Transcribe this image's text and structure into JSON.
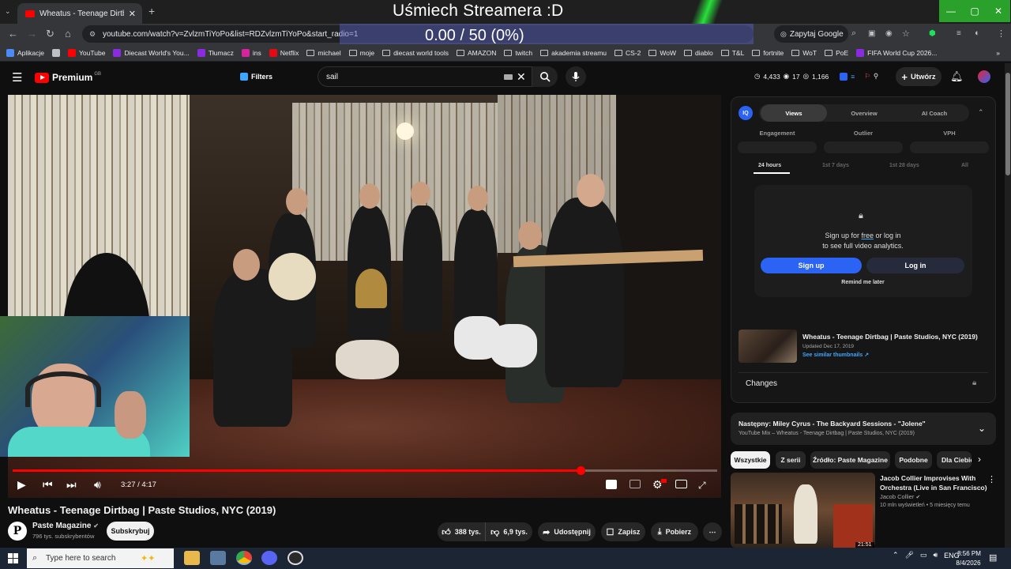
{
  "browser": {
    "tab_title": "Wheatus - Teenage Dirtbag | Pa",
    "url": "youtube.com/watch?v=ZvlzmTiYoPo&list=RDZvlzmTiYoPo&start_radio=1",
    "ask_google_label": "Zapytaj Google"
  },
  "overlay": {
    "stream_title": "Uśmiech Streamera :D",
    "counter": "0.00 / 50 (0%)"
  },
  "bookmarks": [
    {
      "label": "Aplikacje",
      "kind": "apps"
    },
    {
      "label": "",
      "kind": "grid"
    },
    {
      "label": "YouTube",
      "kind": "yt"
    },
    {
      "label": "Diecast World's You...",
      "kind": "site"
    },
    {
      "label": "Tłumacz",
      "kind": "site"
    },
    {
      "label": "ins",
      "kind": "insta"
    },
    {
      "label": "Netflix",
      "kind": "netflix"
    },
    {
      "label": "michael",
      "kind": "folder"
    },
    {
      "label": "moje",
      "kind": "folder"
    },
    {
      "label": "diecast world tools",
      "kind": "folder"
    },
    {
      "label": "AMAZON",
      "kind": "folder"
    },
    {
      "label": "twitch",
      "kind": "folder"
    },
    {
      "label": "akademia streamu",
      "kind": "folder"
    },
    {
      "label": "CS-2",
      "kind": "folder"
    },
    {
      "label": "WoW",
      "kind": "folder"
    },
    {
      "label": "diablo",
      "kind": "folder"
    },
    {
      "label": "T&L",
      "kind": "folder"
    },
    {
      "label": "fortnite",
      "kind": "folder"
    },
    {
      "label": "WoT",
      "kind": "folder"
    },
    {
      "label": "PoE",
      "kind": "folder"
    },
    {
      "label": "FIFA World Cup 2026...",
      "kind": "site"
    }
  ],
  "header": {
    "brand": "Premium",
    "brand_region": "GB",
    "filters_label": "Filters",
    "search_value": "sail",
    "stats": {
      "views": "4,433",
      "watch": "17",
      "eye": "1,166"
    },
    "create_label": "Utwórz"
  },
  "player": {
    "current_time": "3:27 / 4:17",
    "progress": 0.806
  },
  "video": {
    "title": "Wheatus - Teenage Dirtbag | Paste Studios, NYC (2019)",
    "channel": "Paste Magazine",
    "channel_initial": "P",
    "subscribers": "796 tys. subskrybentów",
    "subscribe_label": "Subskrybuj",
    "likes": "388 tys.",
    "dislikes": "6,9 tys.",
    "share_label": "Udostępnij",
    "save_label": "Zapisz",
    "download_label": "Pobierz"
  },
  "iq_panel": {
    "badge": "IQ",
    "tabs": [
      "Views",
      "Overview",
      "AI Coach"
    ],
    "metrics": [
      "Engagement",
      "Outlier",
      "VPH"
    ],
    "periods": [
      "24 hours",
      "1st 7 days",
      "1st 28 days",
      "All"
    ],
    "signup_text_a": "Sign up for ",
    "signup_text_free": "free",
    "signup_text_b": " or log in",
    "signup_text_c": "to see full video analytics.",
    "signup_label": "Sign up",
    "login_label": "Log in",
    "remind_label": "Remind me later",
    "thumb_title": "Wheatus - Teenage Dirtbag | Paste Studios, NYC (2019)",
    "thumb_date": "Updated Dec 17, 2019",
    "thumb_link": "See similar thumbnails ↗",
    "changes_label": "Changes"
  },
  "next_up": {
    "title": "Następny: Miley Cyrus - The Backyard Sessions - \"Jolene\"",
    "subtitle": "YouTube Mix – Wheatus - Teenage Dirtbag | Paste Studios, NYC (2019)"
  },
  "chips": [
    "Wszystkie",
    "Z serii",
    "Źródło: Paste Magazine",
    "Podobne",
    "Dla Ciebie"
  ],
  "recommendation": {
    "title": "Jacob Collier Improvises With Orchestra (Live in San Francisco)",
    "channel": "Jacob Collier",
    "meta": "10 mln wyświetleń • 5 miesięcy temu",
    "duration": "21:51"
  },
  "taskbar": {
    "search_placeholder": "Type here to search",
    "lang": "ENG",
    "time": "8:56 PM",
    "date": "8/4/2026"
  },
  "colors": {
    "accent_red": "#ff0000",
    "iq_blue": "#2b64f5",
    "link_blue": "#3ea6ff",
    "window_green": "#2aa12a"
  }
}
